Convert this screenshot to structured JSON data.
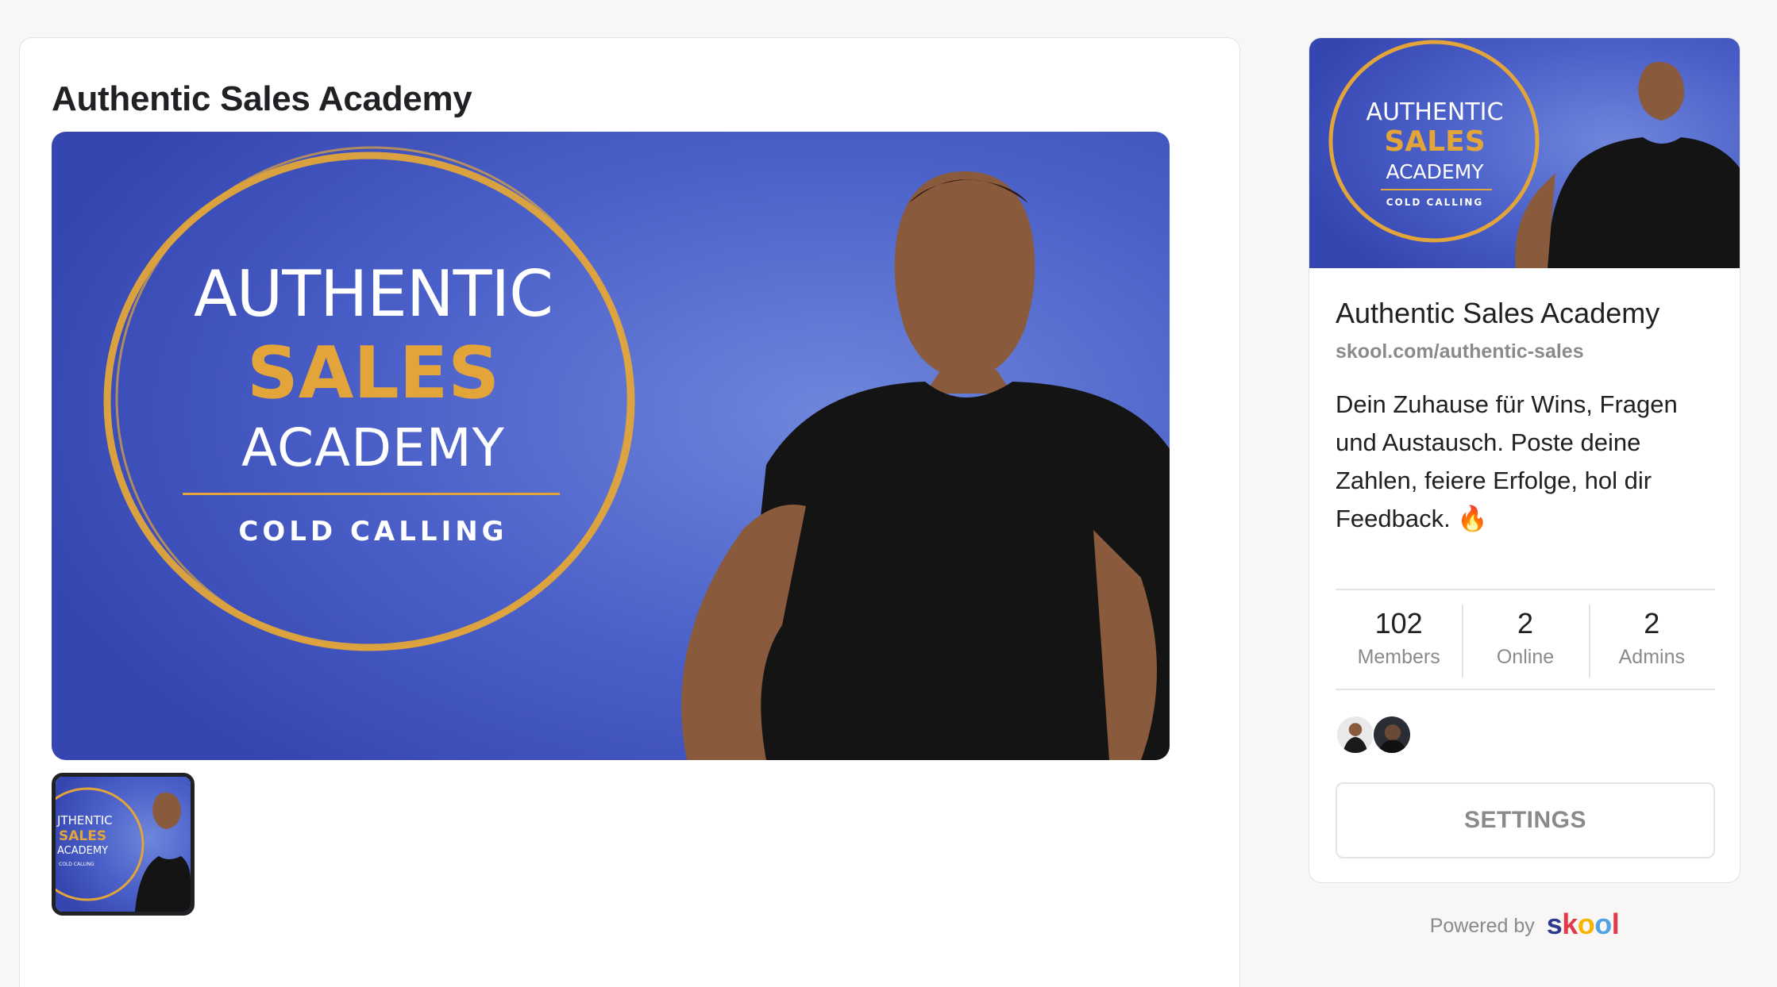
{
  "main": {
    "title": "Authentic Sales Academy"
  },
  "hero": {
    "line1": "AUTHENTIC",
    "line2": "SALES",
    "line3": "ACADEMY",
    "line4": "COLD CALLING"
  },
  "colors": {
    "banner_blue": "#3d55c0",
    "accent_gold": "#e3a53a",
    "button_gray": "#8a8a8a"
  },
  "sidebar": {
    "title": "Authentic Sales Academy",
    "url": "skool.com/authentic-sales",
    "description": "Dein Zuhause für Wins, Fragen und Austausch. Poste deine Zahlen, feiere Erfolge, hol dir Feedback. 🔥",
    "stats": [
      {
        "value": "102",
        "label": "Members"
      },
      {
        "value": "2",
        "label": "Online"
      },
      {
        "value": "2",
        "label": "Admins"
      }
    ],
    "settings_label": "SETTINGS"
  },
  "footer": {
    "powered_by": "Powered by",
    "logo_letters": [
      "s",
      "k",
      "o",
      "o",
      "l"
    ],
    "logo_colors": [
      "#2e3a8c",
      "#e0394a",
      "#f5b500",
      "#4fa3e0",
      "#e0394a"
    ]
  }
}
